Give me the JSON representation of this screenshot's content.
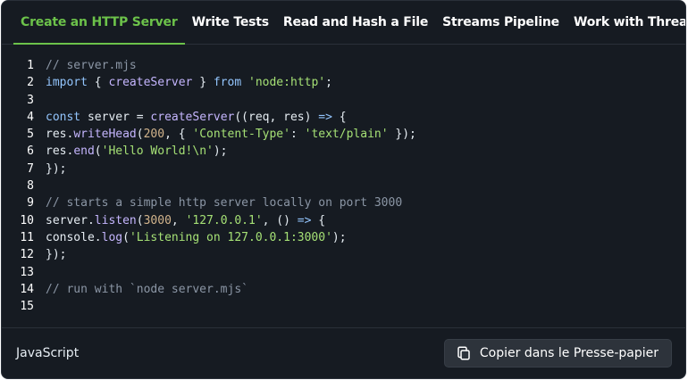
{
  "tabs": [
    {
      "label": "Create an HTTP Server",
      "active": true
    },
    {
      "label": "Write Tests",
      "active": false
    },
    {
      "label": "Read and Hash a File",
      "active": false
    },
    {
      "label": "Streams Pipeline",
      "active": false
    },
    {
      "label": "Work with Threads",
      "active": false
    }
  ],
  "code_lines": [
    {
      "n": "1",
      "tokens": [
        {
          "t": "comment",
          "v": "// server.mjs"
        }
      ]
    },
    {
      "n": "2",
      "tokens": [
        {
          "t": "keyword",
          "v": "import"
        },
        {
          "t": "plain",
          "v": " { "
        },
        {
          "t": "fn",
          "v": "createServer"
        },
        {
          "t": "plain",
          "v": " } "
        },
        {
          "t": "keyword",
          "v": "from"
        },
        {
          "t": "plain",
          "v": " "
        },
        {
          "t": "string",
          "v": "'node:http'"
        },
        {
          "t": "plain",
          "v": ";"
        }
      ]
    },
    {
      "n": "3",
      "tokens": []
    },
    {
      "n": "4",
      "tokens": [
        {
          "t": "keyword",
          "v": "const"
        },
        {
          "t": "plain",
          "v": " server = "
        },
        {
          "t": "fn",
          "v": "createServer"
        },
        {
          "t": "plain",
          "v": "((req, res) "
        },
        {
          "t": "keyword",
          "v": "=>"
        },
        {
          "t": "plain",
          "v": " {"
        }
      ]
    },
    {
      "n": "5",
      "tokens": [
        {
          "t": "plain",
          "v": "res."
        },
        {
          "t": "fn",
          "v": "writeHead"
        },
        {
          "t": "plain",
          "v": "("
        },
        {
          "t": "number",
          "v": "200"
        },
        {
          "t": "plain",
          "v": ", { "
        },
        {
          "t": "string",
          "v": "'Content-Type'"
        },
        {
          "t": "plain",
          "v": ": "
        },
        {
          "t": "string",
          "v": "'text/plain'"
        },
        {
          "t": "plain",
          "v": " });"
        }
      ]
    },
    {
      "n": "6",
      "tokens": [
        {
          "t": "plain",
          "v": "res."
        },
        {
          "t": "fn",
          "v": "end"
        },
        {
          "t": "plain",
          "v": "("
        },
        {
          "t": "string",
          "v": "'Hello World!\\n'"
        },
        {
          "t": "plain",
          "v": ");"
        }
      ]
    },
    {
      "n": "7",
      "tokens": [
        {
          "t": "plain",
          "v": "});"
        }
      ]
    },
    {
      "n": "8",
      "tokens": []
    },
    {
      "n": "9",
      "tokens": [
        {
          "t": "comment",
          "v": "// starts a simple http server locally on port 3000"
        }
      ]
    },
    {
      "n": "10",
      "tokens": [
        {
          "t": "plain",
          "v": "server."
        },
        {
          "t": "fn",
          "v": "listen"
        },
        {
          "t": "plain",
          "v": "("
        },
        {
          "t": "number",
          "v": "3000"
        },
        {
          "t": "plain",
          "v": ", "
        },
        {
          "t": "string",
          "v": "'127.0.0.1'"
        },
        {
          "t": "plain",
          "v": ", () "
        },
        {
          "t": "keyword",
          "v": "=>"
        },
        {
          "t": "plain",
          "v": " {"
        }
      ]
    },
    {
      "n": "11",
      "tokens": [
        {
          "t": "plain",
          "v": "console."
        },
        {
          "t": "fn",
          "v": "log"
        },
        {
          "t": "plain",
          "v": "("
        },
        {
          "t": "string",
          "v": "'Listening on 127.0.0.1:3000'"
        },
        {
          "t": "plain",
          "v": ");"
        }
      ]
    },
    {
      "n": "12",
      "tokens": [
        {
          "t": "plain",
          "v": "});"
        }
      ]
    },
    {
      "n": "13",
      "tokens": []
    },
    {
      "n": "14",
      "tokens": [
        {
          "t": "comment",
          "v": "// run with `node server.mjs`"
        }
      ]
    },
    {
      "n": "15",
      "tokens": []
    }
  ],
  "footer": {
    "language": "JavaScript",
    "copy_label": "Copier dans le Presse-papier",
    "copy_icon": "copy-icon"
  },
  "colors": {
    "panel_bg": "#161b22",
    "accent": "#6cc24a",
    "comment": "#8b96a5",
    "keyword": "#93c5fd",
    "function": "#c4b5fd",
    "string": "#a5e075",
    "number": "#d2b48c"
  }
}
